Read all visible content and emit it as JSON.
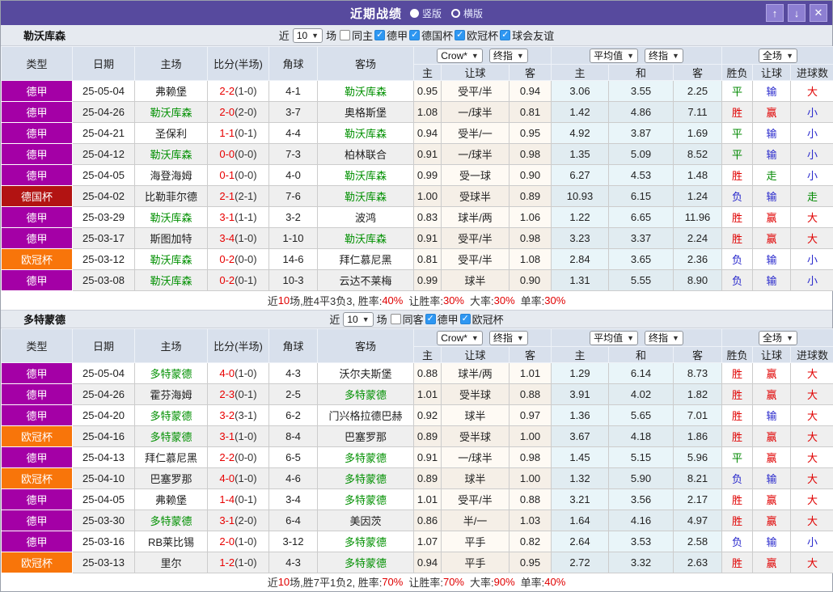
{
  "icons": {
    "arrow_up": "↑",
    "arrow_down": "↓",
    "close": "✕",
    "chevron_down": "▼"
  },
  "titlebar": {
    "title": "近期战绩",
    "radio_vertical": "竖版",
    "radio_horizontal": "横版"
  },
  "table_headers": {
    "type": "类型",
    "date": "日期",
    "home": "主场",
    "score": "比分(半场)",
    "corner": "角球",
    "away": "客场",
    "sel_crow": "Crow*",
    "sel_final": "终指",
    "sel_avg": "平均值",
    "sel_final2": "终指",
    "sel_scope": "全场",
    "col_home": "主",
    "col_handicap": "让球",
    "col_away": "客",
    "col_avg_home": "主",
    "col_draw": "和",
    "col_avg_away": "客",
    "col_wdl": "胜负",
    "col_handicap_result": "让球",
    "col_goals": "进球数"
  },
  "colors": {
    "titlebar": "#574a9e",
    "bundesliga_badge": "#a400a6",
    "dfb_pokal_badge": "#b21312",
    "champions_league_badge": "#f8750a",
    "self_team": "#009000",
    "win_text": "#e00000",
    "draw_text": "#008800",
    "lose_text": "#2828cc",
    "checkbox_checked": "#2e97f2"
  },
  "sections": [
    {
      "team": "勒沃库森",
      "filter": {
        "near_label": "近",
        "count": "10",
        "games_label": "场",
        "checkboxes": [
          {
            "label": "同主",
            "checked": false
          },
          {
            "label": "德甲",
            "checked": true
          },
          {
            "label": "德国杯",
            "checked": true
          },
          {
            "label": "欧冠杯",
            "checked": true
          },
          {
            "label": "球会友谊",
            "checked": true
          }
        ]
      },
      "rows": [
        {
          "comp": "德甲",
          "comp_class": "purple",
          "date": "25-05-04",
          "home": "弗赖堡",
          "home_self": false,
          "score": "2-2",
          "half": "(1-0)",
          "corner": "4-1",
          "away": "勒沃库森",
          "away_self": true,
          "crow_home": "0.95",
          "crow_handicap": "受平/半",
          "crow_away": "0.94",
          "avg_home": "3.06",
          "avg_draw": "3.55",
          "avg_away": "2.25",
          "wdl": "平",
          "wdl_c": "green",
          "hcp": "输",
          "hcp_c": "blue",
          "size": "大",
          "size_c": "red"
        },
        {
          "comp": "德甲",
          "comp_class": "purple",
          "date": "25-04-26",
          "home": "勒沃库森",
          "home_self": true,
          "score": "2-0",
          "half": "(2-0)",
          "corner": "3-7",
          "away": "奥格斯堡",
          "away_self": false,
          "crow_home": "1.08",
          "crow_handicap": "一/球半",
          "crow_away": "0.81",
          "avg_home": "1.42",
          "avg_draw": "4.86",
          "avg_away": "7.11",
          "wdl": "胜",
          "wdl_c": "red",
          "hcp": "赢",
          "hcp_c": "red",
          "size": "小",
          "size_c": "blue"
        },
        {
          "comp": "德甲",
          "comp_class": "purple",
          "date": "25-04-21",
          "home": "圣保利",
          "home_self": false,
          "score": "1-1",
          "half": "(0-1)",
          "corner": "4-4",
          "away": "勒沃库森",
          "away_self": true,
          "crow_home": "0.94",
          "crow_handicap": "受半/一",
          "crow_away": "0.95",
          "avg_home": "4.92",
          "avg_draw": "3.87",
          "avg_away": "1.69",
          "wdl": "平",
          "wdl_c": "green",
          "hcp": "输",
          "hcp_c": "blue",
          "size": "小",
          "size_c": "blue"
        },
        {
          "comp": "德甲",
          "comp_class": "purple",
          "date": "25-04-12",
          "home": "勒沃库森",
          "home_self": true,
          "score": "0-0",
          "half": "(0-0)",
          "corner": "7-3",
          "away": "柏林联合",
          "away_self": false,
          "crow_home": "0.91",
          "crow_handicap": "一/球半",
          "crow_away": "0.98",
          "avg_home": "1.35",
          "avg_draw": "5.09",
          "avg_away": "8.52",
          "wdl": "平",
          "wdl_c": "green",
          "hcp": "输",
          "hcp_c": "blue",
          "size": "小",
          "size_c": "blue"
        },
        {
          "comp": "德甲",
          "comp_class": "purple",
          "date": "25-04-05",
          "home": "海登海姆",
          "home_self": false,
          "score": "0-1",
          "half": "(0-0)",
          "corner": "4-0",
          "away": "勒沃库森",
          "away_self": true,
          "crow_home": "0.99",
          "crow_handicap": "受一球",
          "crow_away": "0.90",
          "avg_home": "6.27",
          "avg_draw": "4.53",
          "avg_away": "1.48",
          "wdl": "胜",
          "wdl_c": "red",
          "hcp": "走",
          "hcp_c": "green",
          "size": "小",
          "size_c": "blue"
        },
        {
          "comp": "德国杯",
          "comp_class": "red",
          "date": "25-04-02",
          "home": "比勒菲尔德",
          "home_self": false,
          "score": "2-1",
          "half": "(2-1)",
          "corner": "7-6",
          "away": "勒沃库森",
          "away_self": true,
          "crow_home": "1.00",
          "crow_handicap": "受球半",
          "crow_away": "0.89",
          "avg_home": "10.93",
          "avg_draw": "6.15",
          "avg_away": "1.24",
          "wdl": "负",
          "wdl_c": "blue",
          "hcp": "输",
          "hcp_c": "blue",
          "size": "走",
          "size_c": "green"
        },
        {
          "comp": "德甲",
          "comp_class": "purple",
          "date": "25-03-29",
          "home": "勒沃库森",
          "home_self": true,
          "score": "3-1",
          "half": "(1-1)",
          "corner": "3-2",
          "away": "波鸿",
          "away_self": false,
          "crow_home": "0.83",
          "crow_handicap": "球半/两",
          "crow_away": "1.06",
          "avg_home": "1.22",
          "avg_draw": "6.65",
          "avg_away": "11.96",
          "wdl": "胜",
          "wdl_c": "red",
          "hcp": "赢",
          "hcp_c": "red",
          "size": "大",
          "size_c": "red"
        },
        {
          "comp": "德甲",
          "comp_class": "purple",
          "date": "25-03-17",
          "home": "斯图加特",
          "home_self": false,
          "score": "3-4",
          "half": "(1-0)",
          "corner": "1-10",
          "away": "勒沃库森",
          "away_self": true,
          "crow_home": "0.91",
          "crow_handicap": "受平/半",
          "crow_away": "0.98",
          "avg_home": "3.23",
          "avg_draw": "3.37",
          "avg_away": "2.24",
          "wdl": "胜",
          "wdl_c": "red",
          "hcp": "赢",
          "hcp_c": "red",
          "size": "大",
          "size_c": "red"
        },
        {
          "comp": "欧冠杯",
          "comp_class": "orange",
          "date": "25-03-12",
          "home": "勒沃库森",
          "home_self": true,
          "score": "0-2",
          "half": "(0-0)",
          "corner": "14-6",
          "away": "拜仁慕尼黑",
          "away_self": false,
          "crow_home": "0.81",
          "crow_handicap": "受平/半",
          "crow_away": "1.08",
          "avg_home": "2.84",
          "avg_draw": "3.65",
          "avg_away": "2.36",
          "wdl": "负",
          "wdl_c": "blue",
          "hcp": "输",
          "hcp_c": "blue",
          "size": "小",
          "size_c": "blue"
        },
        {
          "comp": "德甲",
          "comp_class": "purple",
          "date": "25-03-08",
          "home": "勒沃库森",
          "home_self": true,
          "score": "0-2",
          "half": "(0-1)",
          "corner": "10-3",
          "away": "云达不莱梅",
          "away_self": false,
          "crow_home": "0.99",
          "crow_handicap": "球半",
          "crow_away": "0.90",
          "avg_home": "1.31",
          "avg_draw": "5.55",
          "avg_away": "8.90",
          "wdl": "负",
          "wdl_c": "blue",
          "hcp": "输",
          "hcp_c": "blue",
          "size": "小",
          "size_c": "blue"
        }
      ],
      "summary": {
        "pre": "近",
        "count": "10",
        "mid": "场,胜4平3负3, 胜率:",
        "win_rate": "40%",
        "l_handicap": "让胜率:",
        "handicap_rate": "30%",
        "l_big": "大率:",
        "big_rate": "30%",
        "l_single": "单率:",
        "single_rate": "30%"
      }
    },
    {
      "team": "多特蒙德",
      "filter": {
        "near_label": "近",
        "count": "10",
        "games_label": "场",
        "checkboxes": [
          {
            "label": "同客",
            "checked": false
          },
          {
            "label": "德甲",
            "checked": true
          },
          {
            "label": "欧冠杯",
            "checked": true
          }
        ]
      },
      "rows": [
        {
          "comp": "德甲",
          "comp_class": "purple",
          "date": "25-05-04",
          "home": "多特蒙德",
          "home_self": true,
          "score": "4-0",
          "half": "(1-0)",
          "corner": "4-3",
          "away": "沃尔夫斯堡",
          "away_self": false,
          "crow_home": "0.88",
          "crow_handicap": "球半/两",
          "crow_away": "1.01",
          "avg_home": "1.29",
          "avg_draw": "6.14",
          "avg_away": "8.73",
          "wdl": "胜",
          "wdl_c": "red",
          "hcp": "赢",
          "hcp_c": "red",
          "size": "大",
          "size_c": "red"
        },
        {
          "comp": "德甲",
          "comp_class": "purple",
          "date": "25-04-26",
          "home": "霍芬海姆",
          "home_self": false,
          "score": "2-3",
          "half": "(0-1)",
          "corner": "2-5",
          "away": "多特蒙德",
          "away_self": true,
          "crow_home": "1.01",
          "crow_handicap": "受半球",
          "crow_away": "0.88",
          "avg_home": "3.91",
          "avg_draw": "4.02",
          "avg_away": "1.82",
          "wdl": "胜",
          "wdl_c": "red",
          "hcp": "赢",
          "hcp_c": "red",
          "size": "大",
          "size_c": "red"
        },
        {
          "comp": "德甲",
          "comp_class": "purple",
          "date": "25-04-20",
          "home": "多特蒙德",
          "home_self": true,
          "score": "3-2",
          "half": "(3-1)",
          "corner": "6-2",
          "away": "门兴格拉德巴赫",
          "away_self": false,
          "crow_home": "0.92",
          "crow_handicap": "球半",
          "crow_away": "0.97",
          "avg_home": "1.36",
          "avg_draw": "5.65",
          "avg_away": "7.01",
          "wdl": "胜",
          "wdl_c": "red",
          "hcp": "输",
          "hcp_c": "blue",
          "size": "大",
          "size_c": "red"
        },
        {
          "comp": "欧冠杯",
          "comp_class": "orange",
          "date": "25-04-16",
          "home": "多特蒙德",
          "home_self": true,
          "score": "3-1",
          "half": "(1-0)",
          "corner": "8-4",
          "away": "巴塞罗那",
          "away_self": false,
          "crow_home": "0.89",
          "crow_handicap": "受半球",
          "crow_away": "1.00",
          "avg_home": "3.67",
          "avg_draw": "4.18",
          "avg_away": "1.86",
          "wdl": "胜",
          "wdl_c": "red",
          "hcp": "赢",
          "hcp_c": "red",
          "size": "大",
          "size_c": "red"
        },
        {
          "comp": "德甲",
          "comp_class": "purple",
          "date": "25-04-13",
          "home": "拜仁慕尼黑",
          "home_self": false,
          "score": "2-2",
          "half": "(0-0)",
          "corner": "6-5",
          "away": "多特蒙德",
          "away_self": true,
          "crow_home": "0.91",
          "crow_handicap": "一/球半",
          "crow_away": "0.98",
          "avg_home": "1.45",
          "avg_draw": "5.15",
          "avg_away": "5.96",
          "wdl": "平",
          "wdl_c": "green",
          "hcp": "赢",
          "hcp_c": "red",
          "size": "大",
          "size_c": "red"
        },
        {
          "comp": "欧冠杯",
          "comp_class": "orange",
          "date": "25-04-10",
          "home": "巴塞罗那",
          "home_self": false,
          "score": "4-0",
          "half": "(1-0)",
          "corner": "4-6",
          "away": "多特蒙德",
          "away_self": true,
          "crow_home": "0.89",
          "crow_handicap": "球半",
          "crow_away": "1.00",
          "avg_home": "1.32",
          "avg_draw": "5.90",
          "avg_away": "8.21",
          "wdl": "负",
          "wdl_c": "blue",
          "hcp": "输",
          "hcp_c": "blue",
          "size": "大",
          "size_c": "red"
        },
        {
          "comp": "德甲",
          "comp_class": "purple",
          "date": "25-04-05",
          "home": "弗赖堡",
          "home_self": false,
          "score": "1-4",
          "half": "(0-1)",
          "corner": "3-4",
          "away": "多特蒙德",
          "away_self": true,
          "crow_home": "1.01",
          "crow_handicap": "受平/半",
          "crow_away": "0.88",
          "avg_home": "3.21",
          "avg_draw": "3.56",
          "avg_away": "2.17",
          "wdl": "胜",
          "wdl_c": "red",
          "hcp": "赢",
          "hcp_c": "red",
          "size": "大",
          "size_c": "red"
        },
        {
          "comp": "德甲",
          "comp_class": "purple",
          "date": "25-03-30",
          "home": "多特蒙德",
          "home_self": true,
          "score": "3-1",
          "half": "(2-0)",
          "corner": "6-4",
          "away": "美因茨",
          "away_self": false,
          "crow_home": "0.86",
          "crow_handicap": "半/一",
          "crow_away": "1.03",
          "avg_home": "1.64",
          "avg_draw": "4.16",
          "avg_away": "4.97",
          "wdl": "胜",
          "wdl_c": "red",
          "hcp": "赢",
          "hcp_c": "red",
          "size": "大",
          "size_c": "red"
        },
        {
          "comp": "德甲",
          "comp_class": "purple",
          "date": "25-03-16",
          "home": "RB莱比锡",
          "home_self": false,
          "score": "2-0",
          "half": "(1-0)",
          "corner": "3-12",
          "away": "多特蒙德",
          "away_self": true,
          "crow_home": "1.07",
          "crow_handicap": "平手",
          "crow_away": "0.82",
          "avg_home": "2.64",
          "avg_draw": "3.53",
          "avg_away": "2.58",
          "wdl": "负",
          "wdl_c": "blue",
          "hcp": "输",
          "hcp_c": "blue",
          "size": "小",
          "size_c": "blue"
        },
        {
          "comp": "欧冠杯",
          "comp_class": "orange",
          "date": "25-03-13",
          "home": "里尔",
          "home_self": false,
          "score": "1-2",
          "half": "(1-0)",
          "corner": "4-3",
          "away": "多特蒙德",
          "away_self": true,
          "crow_home": "0.94",
          "crow_handicap": "平手",
          "crow_away": "0.95",
          "avg_home": "2.72",
          "avg_draw": "3.32",
          "avg_away": "2.63",
          "wdl": "胜",
          "wdl_c": "red",
          "hcp": "赢",
          "hcp_c": "red",
          "size": "大",
          "size_c": "red"
        }
      ],
      "summary": {
        "pre": "近",
        "count": "10",
        "mid": "场,胜7平1负2, 胜率:",
        "win_rate": "70%",
        "l_handicap": "让胜率:",
        "handicap_rate": "70%",
        "l_big": "大率:",
        "big_rate": "90%",
        "l_single": "单率:",
        "single_rate": "40%"
      }
    }
  ]
}
